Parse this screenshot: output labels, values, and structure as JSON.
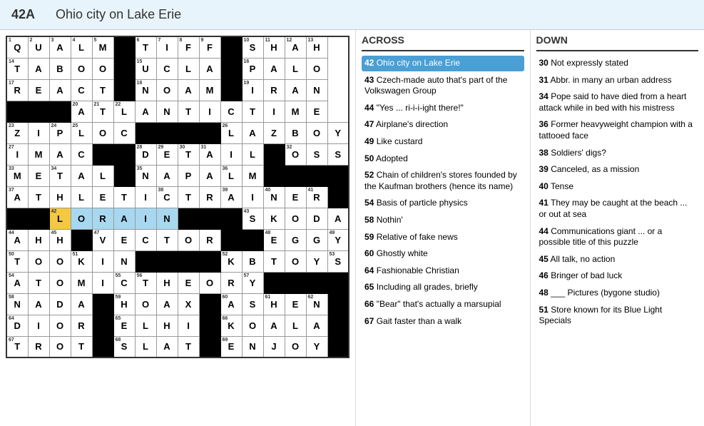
{
  "header": {
    "clue_num": "42A",
    "clue_text": "Ohio city on Lake Erie"
  },
  "across_header": "ACROSS",
  "down_header": "DOWN",
  "across_clues": [
    {
      "num": "42",
      "text": "Ohio city on Lake Erie",
      "active": true
    },
    {
      "num": "43",
      "text": "Czech-made auto that's part of the Volkswagen Group"
    },
    {
      "num": "44",
      "text": "\"Yes ... ri-i-i-ight there!\""
    },
    {
      "num": "47",
      "text": "Airplane's direction"
    },
    {
      "num": "49",
      "text": "Like custard"
    },
    {
      "num": "50",
      "text": "Adopted"
    },
    {
      "num": "52",
      "text": "Chain of children's stores founded by the Kaufman brothers (hence its name)"
    },
    {
      "num": "54",
      "text": "Basis of particle physics"
    },
    {
      "num": "58",
      "text": "Nothin'"
    },
    {
      "num": "59",
      "text": "Relative of fake news"
    },
    {
      "num": "60",
      "text": "Ghostly white"
    },
    {
      "num": "64",
      "text": "Fashionable Christian"
    },
    {
      "num": "65",
      "text": "Including all grades, briefly"
    },
    {
      "num": "66",
      "text": "\"Bear\" that's actually a marsupial"
    },
    {
      "num": "67",
      "text": "Gait faster than a walk"
    }
  ],
  "down_clues": [
    {
      "num": "30",
      "text": "Not expressly stated"
    },
    {
      "num": "31",
      "text": "Abbr. in many an urban address"
    },
    {
      "num": "34",
      "text": "Pope said to have died from a heart attack while in bed with his mistress"
    },
    {
      "num": "36",
      "text": "Former heavyweight champion with a tattooed face"
    },
    {
      "num": "38",
      "text": "Soldiers' digs?"
    },
    {
      "num": "39",
      "text": "Canceled, as a mission"
    },
    {
      "num": "40",
      "text": "Tense"
    },
    {
      "num": "41",
      "text": "They may be caught at the beach ... or out at sea"
    },
    {
      "num": "44",
      "text": "Communications giant ... or a possible title of this puzzle"
    },
    {
      "num": "45",
      "text": "All talk, no action"
    },
    {
      "num": "46",
      "text": "Bringer of bad luck"
    },
    {
      "num": "48",
      "text": "___ Pictures (bygone studio)"
    },
    {
      "num": "51",
      "text": "Store known for its Blue Light Specials"
    }
  ],
  "grid": {
    "rows": 15,
    "cols": 15,
    "cells": [
      [
        "Q1",
        "U2",
        "A3",
        "L4",
        "M5",
        "B",
        "T6",
        "I7",
        "F8",
        "F9",
        "B",
        "S10",
        "H11",
        "A12",
        "H13"
      ],
      [
        "T14",
        "A",
        "B",
        "O",
        "O",
        "B",
        "U15",
        "C",
        "L",
        "A",
        "B",
        "P16",
        "A",
        "L",
        "O"
      ],
      [
        "R17",
        "E",
        "A",
        "C",
        "T",
        "B",
        "N18",
        "O",
        "A",
        "M",
        "B",
        "I19",
        "R",
        "A",
        "N"
      ],
      [
        "B",
        "B",
        "B",
        "A20",
        "T21",
        "L22",
        "A",
        "N",
        "T",
        "I",
        "C",
        "T",
        "I",
        "M",
        "E"
      ],
      [
        "Z23",
        "I",
        "P24",
        "L25",
        "O",
        "C",
        "B",
        "B",
        "B",
        "B",
        "L26",
        "A",
        "Z",
        "B",
        "O27",
        "Y"
      ],
      [
        "I27",
        "M",
        "A",
        "C",
        "B",
        "B",
        "D28",
        "E29",
        "T30",
        "A31",
        "I",
        "L",
        "B",
        "O32",
        "S",
        "S"
      ],
      [
        "M33",
        "E",
        "T34",
        "A",
        "L",
        "B",
        "N35",
        "A",
        "P",
        "A",
        "L36",
        "M",
        "B",
        "B",
        "B",
        "B"
      ],
      [
        "A37",
        "T",
        "H",
        "L",
        "E",
        "T",
        "I",
        "C38",
        "T",
        "R",
        "A39",
        "I",
        "N40",
        "E",
        "R41",
        "B"
      ],
      [
        "B",
        "B",
        "L42H",
        "O",
        "R",
        "A",
        "I",
        "N",
        "B",
        "B",
        "B",
        "S43",
        "K",
        "O",
        "D",
        "A"
      ],
      [
        "A44",
        "H",
        "H45",
        "B",
        "V47",
        "E",
        "C",
        "T",
        "O",
        "R",
        "B",
        "B",
        "E48",
        "G",
        "G",
        "Y49"
      ],
      [
        "T50",
        "O",
        "O",
        "K51",
        "I",
        "N",
        "B",
        "B",
        "B",
        "B",
        "K52",
        "B",
        "T",
        "O",
        "Y",
        "S53"
      ],
      [
        "A54",
        "T",
        "O",
        "M",
        "I",
        "C55",
        "T56",
        "H",
        "E",
        "O",
        "R",
        "Y57",
        "B",
        "B",
        "B",
        "B"
      ],
      [
        "N58",
        "A",
        "D",
        "A",
        "B",
        "H59",
        "O",
        "A",
        "X",
        "B",
        "A60",
        "S",
        "H61",
        "E",
        "N62",
        "B63"
      ],
      [
        "D64",
        "I",
        "O",
        "R",
        "B",
        "E65",
        "L",
        "H",
        "I",
        "B",
        "K66",
        "O",
        "A",
        "L",
        "A",
        "B"
      ],
      [
        "T67",
        "R",
        "O",
        "T",
        "B",
        "S68",
        "L",
        "A",
        "T",
        "B",
        "E69",
        "N",
        "J",
        "O",
        "Y",
        "B"
      ]
    ]
  }
}
